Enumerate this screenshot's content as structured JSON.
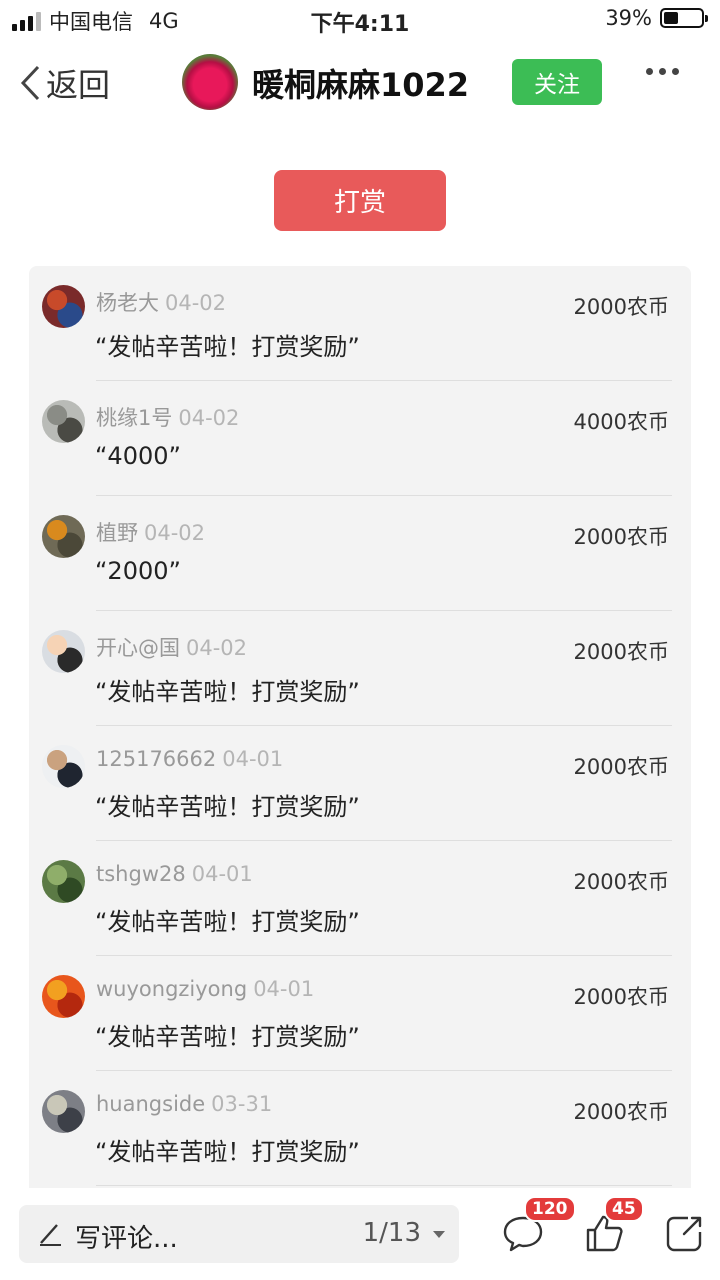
{
  "status_bar": {
    "carrier": "中国电信",
    "network": "4G",
    "time": "下午4:11",
    "battery_pct": "39%",
    "battery_level": 0.39
  },
  "nav": {
    "back_label": "返回",
    "author_name": "暖桐麻麻1022",
    "follow_label": "关注"
  },
  "reward_button": "打赏",
  "rewards": [
    {
      "user": "杨老大",
      "date": "04-02",
      "amount": "2000农币",
      "message": "“发帖辛苦啦！打赏奖励”",
      "avatar_colors": [
        "#7a2a2a",
        "#c84a2a",
        "#2a4a8a"
      ]
    },
    {
      "user": "桃缘1号",
      "date": "04-02",
      "amount": "4000农币",
      "message": "“4000”",
      "avatar_colors": [
        "#b9bbb7",
        "#8a8c86",
        "#4a4a44"
      ]
    },
    {
      "user": "植野",
      "date": "04-02",
      "amount": "2000农币",
      "message": "“2000”",
      "avatar_colors": [
        "#6f6a56",
        "#d98a1e",
        "#4b4838"
      ]
    },
    {
      "user": "开心@国",
      "date": "04-02",
      "amount": "2000农币",
      "message": "“发帖辛苦啦！打赏奖励”",
      "avatar_colors": [
        "#d9dde2",
        "#f6d3b5",
        "#2a2a2a"
      ]
    },
    {
      "user": "125176662",
      "date": "04-01",
      "amount": "2000农币",
      "message": "“发帖辛苦啦！打赏奖励”",
      "avatar_colors": [
        "#eef0f2",
        "#caa27f",
        "#1f2530"
      ]
    },
    {
      "user": "tshgw28",
      "date": "04-01",
      "amount": "2000农币",
      "message": "“发帖辛苦啦！打赏奖励”",
      "avatar_colors": [
        "#5b7a45",
        "#8fae6a",
        "#2f4a24"
      ]
    },
    {
      "user": "wuyongziyong",
      "date": "04-01",
      "amount": "2000农币",
      "message": "“发帖辛苦啦！打赏奖励”",
      "avatar_colors": [
        "#e8561c",
        "#f2a020",
        "#b4280e"
      ]
    },
    {
      "user": "huangside",
      "date": "03-31",
      "amount": "2000农币",
      "message": "“发帖辛苦啦！打赏奖励”",
      "avatar_colors": [
        "#7d7f86",
        "#c9c7b8",
        "#3d4048"
      ]
    }
  ],
  "bottom_bar": {
    "comment_placeholder": "写评论...",
    "page_indicator": "1/13",
    "comment_count": "120",
    "like_count": "45",
    "icons": [
      "pen-icon",
      "comment-icon",
      "thumbs-up-icon",
      "share-icon"
    ]
  }
}
